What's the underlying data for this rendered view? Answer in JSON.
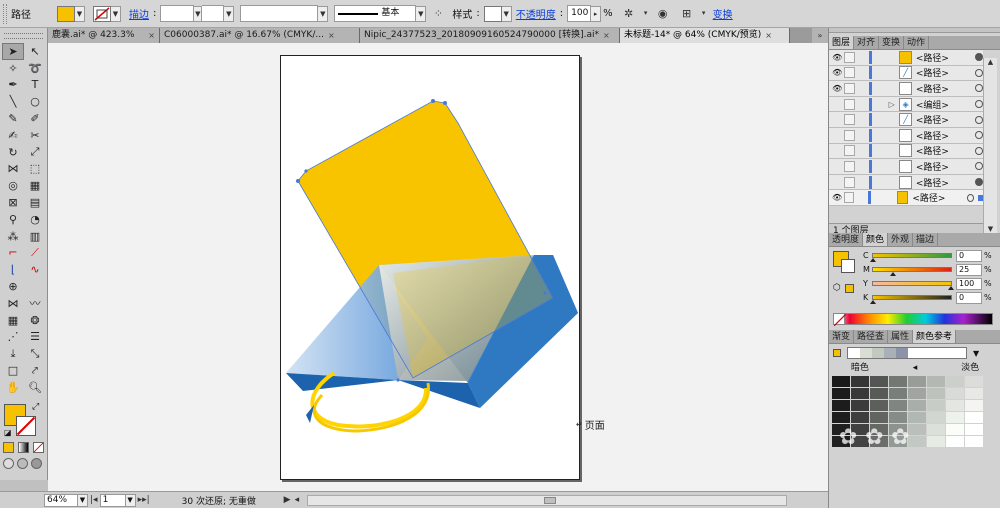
{
  "control_bar": {
    "object_type": "路径",
    "fill_color": "#F6C200",
    "stroke_label": "描边",
    "stroke_profile": "基本",
    "style_label": "样式",
    "opacity_label": "不透明度",
    "opacity_value": "100",
    "opacity_unit": "%",
    "transform_label": "变换"
  },
  "tabs": [
    {
      "label": "鹿囊.ai* @ 423.3% (C...",
      "close": "×",
      "active": false
    },
    {
      "label": "C06000387.ai* @ 16.67% (CMYK/...",
      "close": "×",
      "active": false
    },
    {
      "label": "Nipic_24377523_20180909160524790000 [转换].ai*",
      "close": "×",
      "active": false
    },
    {
      "label": "未标题-14* @ 64% (CMYK/预览)",
      "close": "×",
      "active": true
    }
  ],
  "tools_icons": [
    "selection-icon",
    "direct-selection-icon",
    "magic-wand-icon",
    "lasso-icon",
    "pen-icon",
    "type-icon",
    "line-icon",
    "ellipse-icon",
    "paintbrush-icon",
    "pencil-icon",
    "blob-brush-icon",
    "scissors-icon",
    "rotate-icon",
    "scale-icon",
    "width-icon",
    "free-transform-icon",
    "shape-builder-icon",
    "perspective-icon",
    "mesh-icon",
    "gradient-icon",
    "eyedropper-icon",
    "blend-icon",
    "symbol-sprayer-icon",
    "column-graph-icon",
    "artboard-icon",
    "slice-icon",
    "hand-icon",
    "zoom-icon"
  ],
  "status_bar": {
    "zoom": "64%",
    "artboard_index": "1",
    "undo_text": "30 次还原; 无重做"
  },
  "canvas": {
    "page_label": "页面"
  },
  "layers_panel": {
    "tabs": [
      "图层",
      "对齐",
      "变换",
      "动作"
    ],
    "rows": [
      {
        "name": "<路径>",
        "visible": true,
        "filled": true
      },
      {
        "name": "<路径>",
        "visible": true,
        "filled": false
      },
      {
        "name": "<路径>",
        "visible": true,
        "filled": false
      },
      {
        "name": "<编组>",
        "visible": false,
        "filled": false,
        "group": true
      },
      {
        "name": "<路径>",
        "visible": false,
        "filled": false
      },
      {
        "name": "<路径>",
        "visible": false,
        "filled": false
      },
      {
        "name": "<路径>",
        "visible": false,
        "filled": false
      },
      {
        "name": "<路径>",
        "visible": false,
        "filled": false
      },
      {
        "name": "<路径>",
        "visible": false,
        "filled": true
      },
      {
        "name": "<路径>",
        "visible": true,
        "filled": false,
        "selected": true
      }
    ],
    "footer": "1 个图层"
  },
  "color_panel": {
    "tabs": [
      "透明度",
      "颜色",
      "外观",
      "描边"
    ],
    "channels": [
      {
        "label": "C",
        "value": "0",
        "unit": "%"
      },
      {
        "label": "M",
        "value": "25",
        "unit": "%"
      },
      {
        "label": "Y",
        "value": "100",
        "unit": "%"
      },
      {
        "label": "K",
        "value": "0",
        "unit": "%"
      }
    ]
  },
  "guide_panel": {
    "tabs": [
      "渐变",
      "路径查",
      "属性",
      "颜色参考"
    ],
    "dark_label": "暗色",
    "light_label": "淡色"
  }
}
